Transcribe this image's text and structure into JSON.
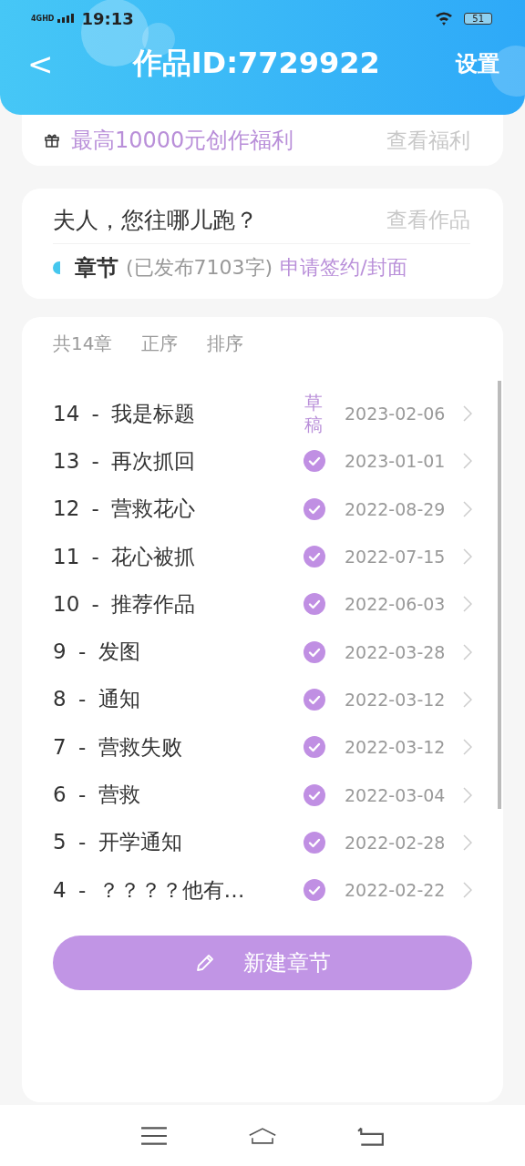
{
  "status_bar": {
    "network": "4GHD",
    "time": "19:13",
    "battery": "51"
  },
  "header": {
    "back": "<",
    "title": "作品ID:7729922",
    "action": "设置"
  },
  "welfare": {
    "text": "最高10000元创作福利",
    "link": "查看福利"
  },
  "work": {
    "title": "夫人，您往哪儿跑？",
    "link": "查看作品",
    "section": "章节",
    "published": "(已发布7103字)",
    "apply": "申请签约/封面"
  },
  "chapters": {
    "count": "共14章",
    "order": "正序",
    "sort": "排序",
    "items": [
      {
        "label": "14 - 我是标题",
        "kind": "draft",
        "status": "草稿",
        "date": "2023-02-06"
      },
      {
        "label": "13 - 再次抓回",
        "kind": "published",
        "date": "2023-01-01"
      },
      {
        "label": "12 - 营救花心",
        "kind": "published",
        "date": "2022-08-29"
      },
      {
        "label": "11 - 花心被抓",
        "kind": "published",
        "date": "2022-07-15"
      },
      {
        "label": "10 - 推荐作品",
        "kind": "published",
        "date": "2022-06-03"
      },
      {
        "label": "9 - 发图",
        "kind": "published",
        "date": "2022-03-28"
      },
      {
        "label": "8 - 通知",
        "kind": "published",
        "date": "2022-03-12"
      },
      {
        "label": "7 - 营救失败",
        "kind": "published",
        "date": "2022-03-12"
      },
      {
        "label": "6 - 营救",
        "kind": "published",
        "date": "2022-03-04"
      },
      {
        "label": "5 - 开学通知",
        "kind": "published",
        "date": "2022-02-28"
      },
      {
        "label": "4 - ？？？？他有…",
        "kind": "published",
        "date": "2022-02-22"
      }
    ]
  },
  "new_chapter_button": "新建章节"
}
